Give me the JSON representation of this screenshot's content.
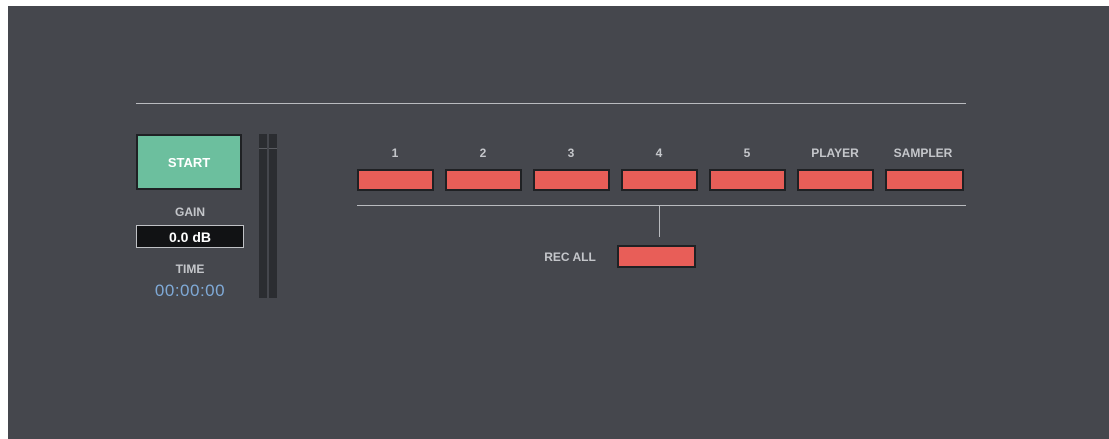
{
  "transport": {
    "start_label": "START",
    "start_color": "#6cbf9e"
  },
  "gain": {
    "label": "GAIN",
    "value": "0.0 dB"
  },
  "time": {
    "label": "TIME",
    "value": "00:00:00",
    "color": "#7fa9d6"
  },
  "channels": [
    {
      "label": "1"
    },
    {
      "label": "2"
    },
    {
      "label": "3"
    },
    {
      "label": "4"
    },
    {
      "label": "5"
    },
    {
      "label": "PLAYER"
    },
    {
      "label": "SAMPLER"
    }
  ],
  "rec_all": {
    "label": "REC ALL"
  },
  "colors": {
    "background": "#45474d",
    "record": "#e85e58",
    "line": "#b9bbbf"
  }
}
